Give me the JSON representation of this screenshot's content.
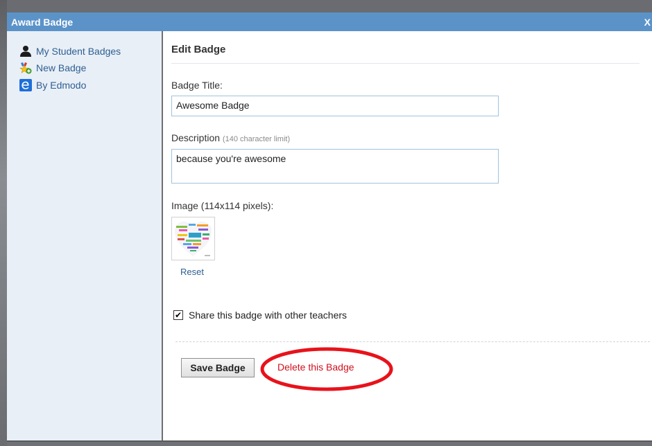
{
  "dialog": {
    "title": "Award Badge",
    "close_label": "X"
  },
  "sidebar": {
    "items": [
      {
        "label": "My Student Badges",
        "icon": "person-icon"
      },
      {
        "label": "New Badge",
        "icon": "new-badge-star-icon"
      },
      {
        "label": "By Edmodo",
        "icon": "edmodo-logo-icon"
      }
    ]
  },
  "form": {
    "heading": "Edit Badge",
    "title_label": "Badge Title:",
    "title_value": "Awesome Badge",
    "description_label": "Description",
    "description_hint": "(140 character limit)",
    "description_value": "because you're awesome",
    "image_label": "Image (114x114 pixels):",
    "reset_label": "Reset",
    "share_label": "Share this badge with other teachers",
    "share_checked": true,
    "save_label": "Save Badge",
    "delete_label": "Delete this Badge"
  },
  "colors": {
    "titlebar": "#5b93c9",
    "sidebar_bg": "#e9eff7",
    "link": "#2d5f91",
    "delete": "#d0101e",
    "highlight_ellipse": "#e8121b"
  }
}
